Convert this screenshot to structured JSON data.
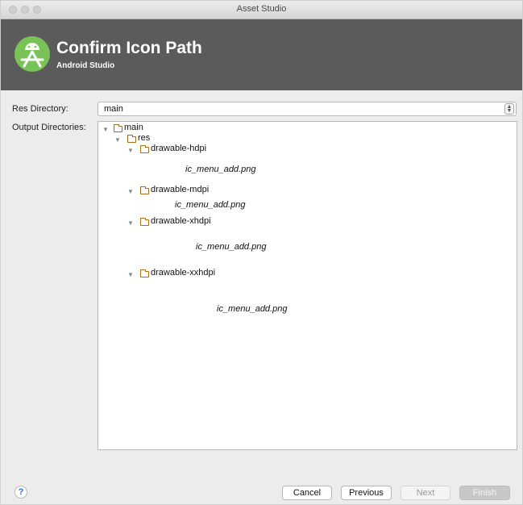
{
  "window": {
    "title": "Asset Studio"
  },
  "header": {
    "title": "Confirm Icon Path",
    "subtitle": "Android Studio"
  },
  "form": {
    "res_directory_label": "Res Directory:",
    "res_directory_value": "main",
    "output_directories_label": "Output Directories:"
  },
  "tree": {
    "root": "main",
    "res": "res",
    "folders": [
      {
        "name": "drawable-hdpi",
        "file": "ic_menu_add.png"
      },
      {
        "name": "drawable-mdpi",
        "file": "ic_menu_add.png"
      },
      {
        "name": "drawable-xhdpi",
        "file": "ic_menu_add.png"
      },
      {
        "name": "drawable-xxhdpi",
        "file": "ic_menu_add.png"
      }
    ]
  },
  "footer": {
    "help": "?",
    "cancel": "Cancel",
    "previous": "Previous",
    "next": "Next",
    "finish": "Finish"
  },
  "colors": {
    "header_bg": "#5b5b5b",
    "logo_green": "#78c257",
    "folder": "#a86d1a"
  }
}
